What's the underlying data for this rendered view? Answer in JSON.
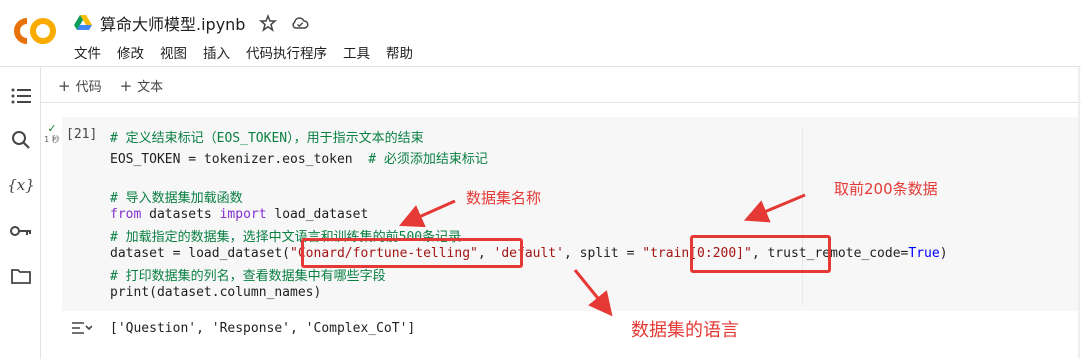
{
  "app": {
    "logo_text": "CO",
    "doc_title": "算命大师模型.ipynb",
    "menu": [
      "文件",
      "修改",
      "视图",
      "插入",
      "代码执行程序",
      "工具",
      "帮助"
    ],
    "colors": {
      "logo_orange": "#f9ab00",
      "logo_dark": "#e8710a",
      "annotation_red": "#e53935"
    }
  },
  "toolbar": {
    "add_code": "代码",
    "add_text": "文本"
  },
  "sidebar": {
    "icons": [
      "table-of-contents-icon",
      "search-icon",
      "variables-icon",
      "key-icon",
      "folder-icon"
    ]
  },
  "cell": {
    "exec_count": "[21]",
    "run_time": "1 秒",
    "lines": {
      "l1": "# 定义结束标记（EOS_TOKEN），用于指示文本的结束",
      "l2_code": "EOS_TOKEN = tokenizer.eos_token  ",
      "l2_comment": "# 必须添加结束标记",
      "l4": "# 导入数据集加载函数",
      "l5_from": "from",
      "l5_mid": " datasets ",
      "l5_import": "import",
      "l5_end": " load_dataset",
      "l6": "# 加载指定的数据集，选择中文语言和训练集的前500条记录",
      "l7_a": "dataset = load_dataset(",
      "l7_str1": "\"Conard/fortune-telling\"",
      "l7_b": ", ",
      "l7_str2": "'default'",
      "l7_c": ", split = ",
      "l7_str3": "\"train[0:200]\"",
      "l7_d": ", trust_remote_code=",
      "l7_true": "True",
      "l7_e": ")",
      "l8": "# 打印数据集的列名，查看数据集中有哪些字段",
      "l9": "print(dataset.column_names)"
    },
    "output": "['Question', 'Response', 'Complex_CoT']"
  },
  "annotations": {
    "dataset_name": "数据集名称",
    "first_200": "取前200条数据",
    "dataset_language": "数据集的语言"
  }
}
